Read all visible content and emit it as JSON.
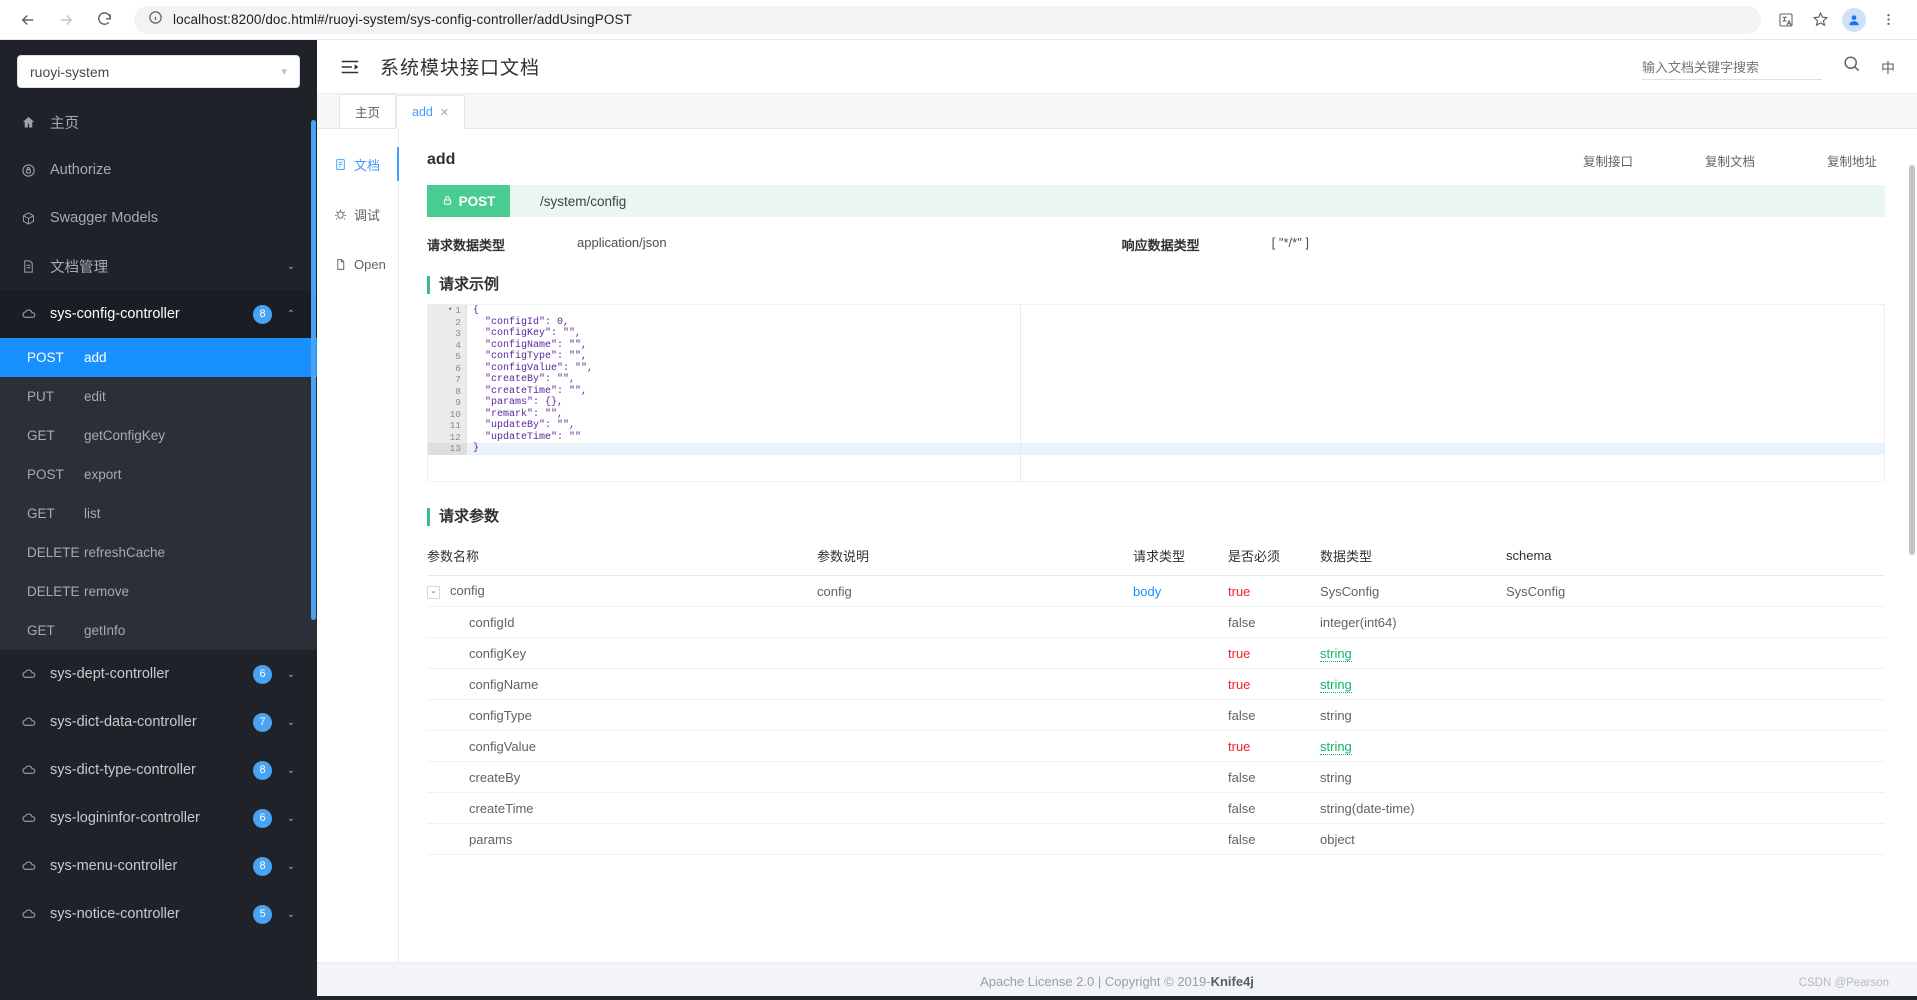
{
  "browser": {
    "url": "localhost:8200/doc.html#/ruoyi-system/sys-config-controller/addUsingPOST",
    "back_icon": "back-arrow-icon",
    "forward_icon": "forward-arrow-icon",
    "reload_icon": "reload-icon",
    "info_icon": "site-info-icon",
    "translate_icon": "translate-icon",
    "bookmark_icon": "star-icon",
    "profile_icon": "profile-avatar-icon",
    "menu_icon": "three-dot-menu-icon"
  },
  "sidebar": {
    "project": "ruoyi-system",
    "nav": [
      {
        "label": "主页",
        "icon": "home-icon"
      },
      {
        "label": "Authorize",
        "icon": "lock-icon"
      },
      {
        "label": "Swagger Models",
        "icon": "cube-icon"
      },
      {
        "label": "文档管理",
        "icon": "document-icon",
        "chevron": "⌄"
      }
    ],
    "active_group": {
      "label": "sys-config-controller",
      "icon": "cloud-icon",
      "count": "8",
      "chevron": "⌃"
    },
    "endpoints": [
      {
        "method": "POST",
        "name": "add",
        "selected": true
      },
      {
        "method": "PUT",
        "name": "edit",
        "selected": false
      },
      {
        "method": "GET",
        "name": "getConfigKey",
        "selected": false
      },
      {
        "method": "POST",
        "name": "export",
        "selected": false
      },
      {
        "method": "GET",
        "name": "list",
        "selected": false
      },
      {
        "method": "DELETE",
        "name": "refreshCache",
        "selected": false
      },
      {
        "method": "DELETE",
        "name": "remove",
        "selected": false
      },
      {
        "method": "GET",
        "name": "getInfo",
        "selected": false
      }
    ],
    "groups": [
      {
        "label": "sys-dept-controller",
        "count": "6",
        "icon": "cloud-icon",
        "chevron": "⌄"
      },
      {
        "label": "sys-dict-data-controller",
        "count": "7",
        "icon": "cloud-icon",
        "chevron": "⌄"
      },
      {
        "label": "sys-dict-type-controller",
        "count": "8",
        "icon": "cloud-icon",
        "chevron": "⌄"
      },
      {
        "label": "sys-logininfor-controller",
        "count": "6",
        "icon": "cloud-icon",
        "chevron": "⌄"
      },
      {
        "label": "sys-menu-controller",
        "count": "8",
        "icon": "cloud-icon",
        "chevron": "⌄"
      },
      {
        "label": "sys-notice-controller",
        "count": "5",
        "icon": "cloud-icon",
        "chevron": "⌄"
      }
    ]
  },
  "topbar": {
    "collapse_icon": "collapse-menu-icon",
    "title": "系统模块接口文档",
    "search_placeholder": "输入文档关键字搜索",
    "search_value": "",
    "search_icon": "search-icon",
    "lang_label": "中"
  },
  "tabs": [
    {
      "label": "主页",
      "active": false,
      "closable": false
    },
    {
      "label": "add",
      "active": true,
      "closable": true,
      "close_icon": "close-icon"
    }
  ],
  "leftnav": [
    {
      "label": "文档",
      "icon": "doc-icon",
      "active": true
    },
    {
      "label": "调试",
      "icon": "bug-icon",
      "active": false
    },
    {
      "label": "Open",
      "icon": "file-icon",
      "active": false
    }
  ],
  "doc": {
    "api_name": "add",
    "copy_actions": [
      "复制接口",
      "复制文档",
      "复制地址"
    ],
    "method": "POST",
    "method_lock_icon": "lock-icon",
    "url": "/system/config",
    "request_type_label": "请求数据类型",
    "request_type_value": "application/json",
    "response_type_label": "响应数据类型",
    "response_type_value": "[ \"*/*\" ]",
    "example_title": "请求示例",
    "code_lines": [
      {
        "n": "1",
        "text": "{",
        "fold": true
      },
      {
        "n": "2",
        "text": "  \"configId\": 0,"
      },
      {
        "n": "3",
        "text": "  \"configKey\": \"\","
      },
      {
        "n": "4",
        "text": "  \"configName\": \"\","
      },
      {
        "n": "5",
        "text": "  \"configType\": \"\","
      },
      {
        "n": "6",
        "text": "  \"configValue\": \"\","
      },
      {
        "n": "7",
        "text": "  \"createBy\": \"\","
      },
      {
        "n": "8",
        "text": "  \"createTime\": \"\","
      },
      {
        "n": "9",
        "text": "  \"params\": {},"
      },
      {
        "n": "10",
        "text": "  \"remark\": \"\","
      },
      {
        "n": "11",
        "text": "  \"updateBy\": \"\","
      },
      {
        "n": "12",
        "text": "  \"updateTime\": \"\""
      },
      {
        "n": "13",
        "text": "}",
        "current": true
      }
    ],
    "params_title": "请求参数",
    "table_headers": [
      "参数名称",
      "参数说明",
      "请求类型",
      "是否必须",
      "数据类型",
      "schema"
    ],
    "rows": [
      {
        "name": "config",
        "expander": "-",
        "indent": 0,
        "desc": "config",
        "in": "body",
        "required": "true",
        "type": "SysConfig",
        "schema": "SysConfig",
        "type_link": false
      },
      {
        "name": "configId",
        "expander": "",
        "indent": 1,
        "desc": "",
        "in": "",
        "required": "false",
        "type": "integer(int64)",
        "schema": "",
        "type_link": false
      },
      {
        "name": "configKey",
        "expander": "",
        "indent": 1,
        "desc": "",
        "in": "",
        "required": "true",
        "type": "string",
        "schema": "",
        "type_link": true
      },
      {
        "name": "configName",
        "expander": "",
        "indent": 1,
        "desc": "",
        "in": "",
        "required": "true",
        "type": "string",
        "schema": "",
        "type_link": true
      },
      {
        "name": "configType",
        "expander": "",
        "indent": 1,
        "desc": "",
        "in": "",
        "required": "false",
        "type": "string",
        "schema": "",
        "type_link": false
      },
      {
        "name": "configValue",
        "expander": "",
        "indent": 1,
        "desc": "",
        "in": "",
        "required": "true",
        "type": "string",
        "schema": "",
        "type_link": true
      },
      {
        "name": "createBy",
        "expander": "",
        "indent": 1,
        "desc": "",
        "in": "",
        "required": "false",
        "type": "string",
        "schema": "",
        "type_link": false
      },
      {
        "name": "createTime",
        "expander": "",
        "indent": 1,
        "desc": "",
        "in": "",
        "required": "false",
        "type": "string(date-time)",
        "schema": "",
        "type_link": false
      },
      {
        "name": "params",
        "expander": "",
        "indent": 1,
        "desc": "",
        "in": "",
        "required": "false",
        "type": "object",
        "schema": "",
        "type_link": false
      }
    ]
  },
  "footer": {
    "text_before": "Apache License 2.0 | Copyright © 2019-",
    "brand": "Knife4j",
    "watermark": "CSDN @Pearson"
  },
  "colors": {
    "accent": "#1890ff",
    "post_green": "#49cc90",
    "required_red": "#f5222d",
    "type_green": "#13b56a",
    "sidebar_bg": "#20222a"
  }
}
